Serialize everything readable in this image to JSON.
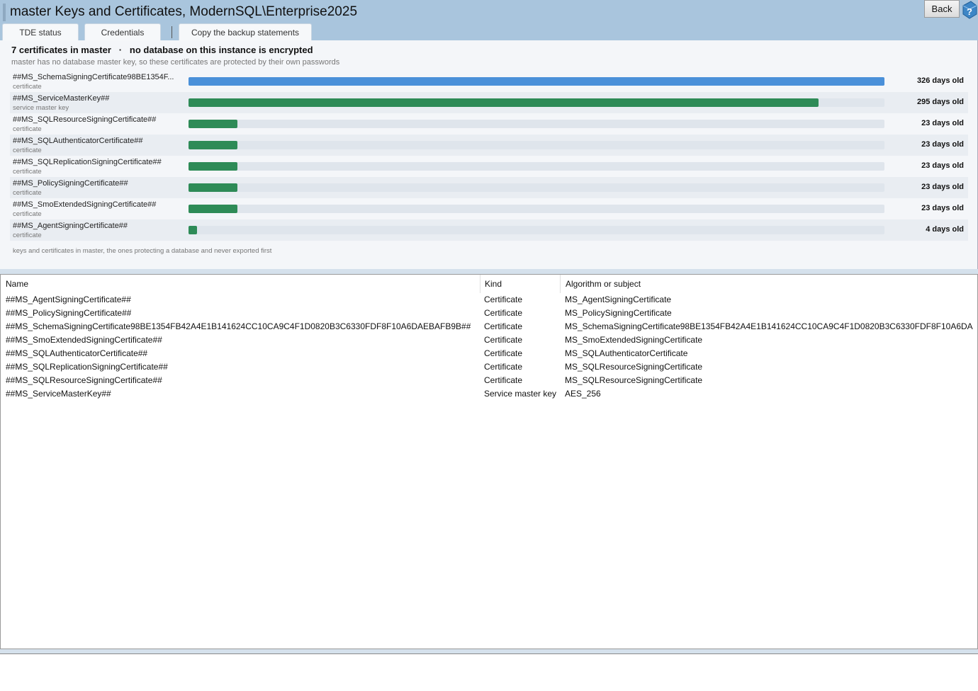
{
  "window": {
    "title": "master Keys and Certificates, ModernSQL\\Enterprise2025",
    "back_label": "Back"
  },
  "tabs": [
    {
      "label": "TDE status"
    },
    {
      "label": "Credentials"
    },
    {
      "label": "Copy the backup statements"
    }
  ],
  "summary": {
    "title": "7 certificates in master   ·   no database on this instance is encrypted",
    "subtitle": "master has no database master key, so these certificates are protected by their own passwords",
    "footnote": "keys and certificates in master, the ones protecting a database and never exported first",
    "colors": {
      "accent": "#4a90d9",
      "normal": "#2e8b57",
      "track": "#dfe5ec"
    },
    "rows": [
      {
        "name": "##MS_SchemaSigningCertificate98BE1354F...",
        "kind": "certificate",
        "age": "326 days old",
        "days": 326,
        "highlight": true
      },
      {
        "name": "##MS_ServiceMasterKey##",
        "kind": "service master key",
        "age": "295 days old",
        "days": 295,
        "highlight": false
      },
      {
        "name": "##MS_SQLResourceSigningCertificate##",
        "kind": "certificate",
        "age": "23 days old",
        "days": 23,
        "highlight": false
      },
      {
        "name": "##MS_SQLAuthenticatorCertificate##",
        "kind": "certificate",
        "age": "23 days old",
        "days": 23,
        "highlight": false
      },
      {
        "name": "##MS_SQLReplicationSigningCertificate##",
        "kind": "certificate",
        "age": "23 days old",
        "days": 23,
        "highlight": false
      },
      {
        "name": "##MS_PolicySigningCertificate##",
        "kind": "certificate",
        "age": "23 days old",
        "days": 23,
        "highlight": false
      },
      {
        "name": "##MS_SmoExtendedSigningCertificate##",
        "kind": "certificate",
        "age": "23 days old",
        "days": 23,
        "highlight": false
      },
      {
        "name": "##MS_AgentSigningCertificate##",
        "kind": "certificate",
        "age": "4 days old",
        "days": 4,
        "highlight": false
      }
    ]
  },
  "grid": {
    "columns": [
      "Name",
      "Kind",
      "Algorithm or subject"
    ],
    "rows": [
      [
        "##MS_AgentSigningCertificate##",
        "Certificate",
        "MS_AgentSigningCertificate"
      ],
      [
        "##MS_PolicySigningCertificate##",
        "Certificate",
        "MS_PolicySigningCertificate"
      ],
      [
        "##MS_SchemaSigningCertificate98BE1354FB42A4E1B141624CC10CA9C4F1D0820B3C6330FDF8F10A6DAEBAFB9B##",
        "Certificate",
        "MS_SchemaSigningCertificate98BE1354FB42A4E1B141624CC10CA9C4F1D0820B3C6330FDF8F10A6DA"
      ],
      [
        "##MS_SmoExtendedSigningCertificate##",
        "Certificate",
        "MS_SmoExtendedSigningCertificate"
      ],
      [
        "##MS_SQLAuthenticatorCertificate##",
        "Certificate",
        "MS_SQLAuthenticatorCertificate"
      ],
      [
        "##MS_SQLReplicationSigningCertificate##",
        "Certificate",
        "MS_SQLResourceSigningCertificate"
      ],
      [
        "##MS_SQLResourceSigningCertificate##",
        "Certificate",
        "MS_SQLResourceSigningCertificate"
      ],
      [
        "##MS_ServiceMasterKey##",
        "Service master key",
        "AES_256"
      ]
    ]
  }
}
